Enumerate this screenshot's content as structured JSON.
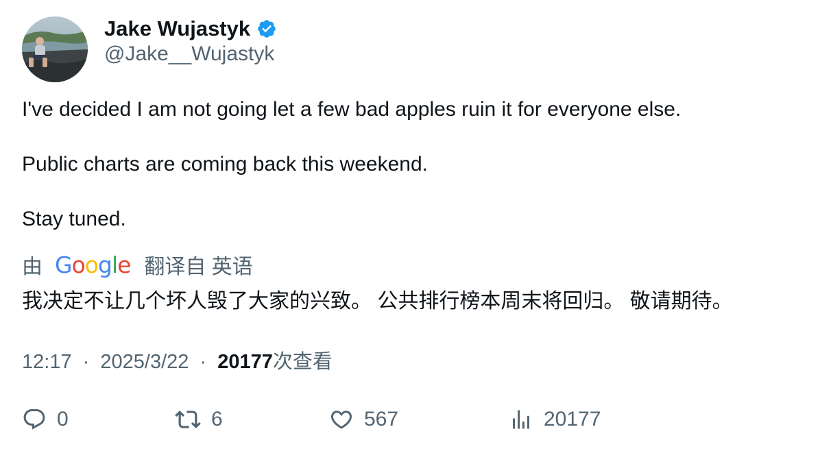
{
  "author": {
    "display_name": "Jake Wujastyk",
    "handle": "@Jake__Wujastyk",
    "verified": true,
    "verified_icon": "verified-badge-icon",
    "verified_color": "#1d9bf0"
  },
  "tweet": {
    "lines": [
      "I've decided I am not going let a few bad apples ruin it for everyone else.",
      "Public charts are coming back this weekend.",
      "Stay tuned."
    ]
  },
  "translation": {
    "prefix": "由",
    "provider": "Google",
    "suffix": "翻译自 英语",
    "text": "我决定不让几个坏人毁了大家的兴致。 公共排行榜本周末将回归。 敬请期待。"
  },
  "meta": {
    "time": "12:17",
    "separator": "·",
    "date": "2025/3/22",
    "views_count": "20177",
    "views_label": "次查看"
  },
  "actions": {
    "reply_count": "0",
    "retweet_count": "6",
    "like_count": "567",
    "views_count": "20177"
  },
  "colors": {
    "text_primary": "#0f1419",
    "text_secondary": "#536471",
    "accent": "#1d9bf0"
  }
}
